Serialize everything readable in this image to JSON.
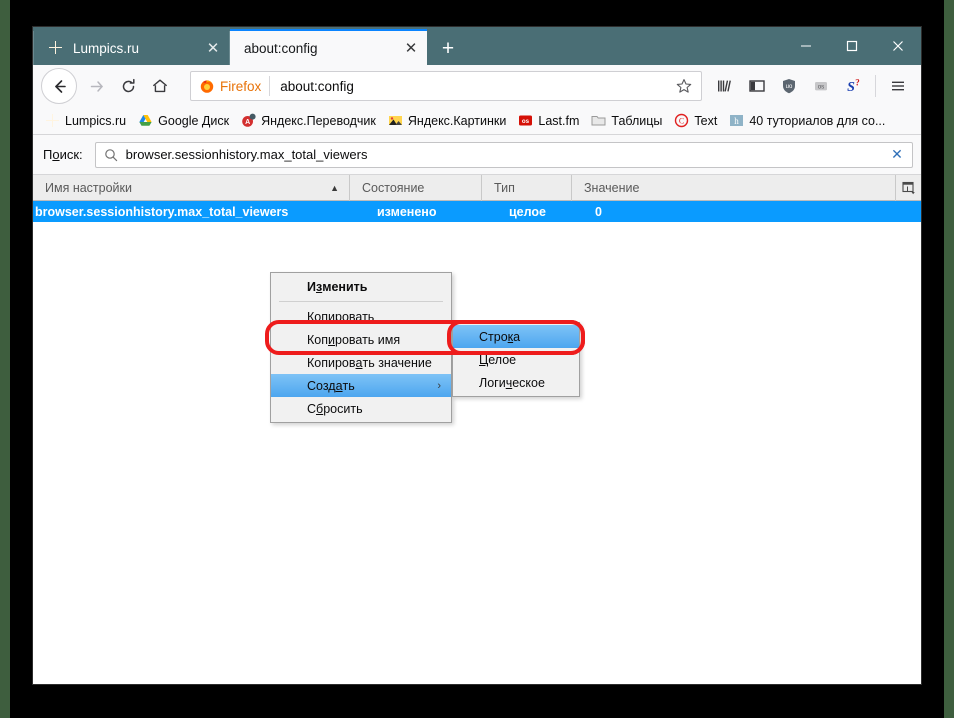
{
  "window": {
    "controls": {
      "minimize": "—",
      "maximize": "☐",
      "close": "✕"
    }
  },
  "tabs": [
    {
      "label": "Lumpics.ru",
      "icon": "lumpics-favicon",
      "close": "✕",
      "active": false
    },
    {
      "label": "about:config",
      "icon": "none",
      "close": "✕",
      "active": true
    }
  ],
  "newtab_label": "+",
  "toolbar": {
    "back_icon": "←",
    "forward_icon": "→",
    "reload_icon": "⟳",
    "home_icon": "⌂",
    "identity_label": "Firefox",
    "url": "about:config",
    "bookmark_star": "☆",
    "icons": [
      "library-icon",
      "sidebar-icon",
      "ublock-shield-icon",
      "os-badge-icon",
      "s-logo-icon"
    ],
    "menu_icon": "☰"
  },
  "bookmarks": [
    {
      "label": "Lumpics.ru",
      "icon": "lumpics-favicon"
    },
    {
      "label": "Google Диск",
      "icon": "google-drive-icon"
    },
    {
      "label": "Яндекс.Переводчик",
      "icon": "yandex-translate-icon"
    },
    {
      "label": "Яндекс.Картинки",
      "icon": "yandex-images-icon"
    },
    {
      "label": "Last.fm",
      "icon": "lastfm-icon"
    },
    {
      "label": "Таблицы",
      "icon": "folder-icon"
    },
    {
      "label": "Text",
      "icon": "copyright-c-icon"
    },
    {
      "label": "40 туториалов для со...",
      "icon": "habr-h-icon"
    }
  ],
  "search": {
    "label_prefix": "П",
    "label_accel": "о",
    "label_suffix": "иск:",
    "value": "browser.sessionhistory.max_total_viewers",
    "placeholder": "Поиск",
    "clear_icon": "✕"
  },
  "table": {
    "columns": [
      {
        "key": "name",
        "label": "Имя настройки",
        "sort": "▲"
      },
      {
        "key": "state",
        "label": "Состояние"
      },
      {
        "key": "type",
        "label": "Тип"
      },
      {
        "key": "value",
        "label": "Значение"
      }
    ],
    "column_picker_icon": "columns-icon",
    "rows": [
      {
        "name": "browser.sessionhistory.max_total_viewers",
        "state": "изменено",
        "type": "целое",
        "value": "0",
        "selected": true
      }
    ]
  },
  "context_menu": {
    "items": [
      {
        "pre": "И",
        "accel": "з",
        "post": "менить",
        "bold": true,
        "submenu": false,
        "selected": false
      },
      {
        "pre": "Ко",
        "accel": "п",
        "post": "ировать",
        "bold": false,
        "submenu": false,
        "selected": false
      },
      {
        "pre": "Коп",
        "accel": "и",
        "post": "ровать имя",
        "bold": false,
        "submenu": false,
        "selected": false
      },
      {
        "pre": "Копиров",
        "accel": "а",
        "post": "ть значение",
        "bold": false,
        "submenu": false,
        "selected": false
      },
      {
        "pre": "Созд",
        "accel": "а",
        "post": "ть",
        "bold": false,
        "submenu": true,
        "selected": true
      },
      {
        "pre": "С",
        "accel": "б",
        "post": "росить",
        "bold": false,
        "submenu": false,
        "selected": false
      }
    ],
    "submenu_arrow": "›"
  },
  "submenu": {
    "items": [
      {
        "pre": "Стро",
        "accel": "к",
        "post": "а",
        "selected": true
      },
      {
        "pre": "",
        "accel": "Ц",
        "post": "елое",
        "selected": false
      },
      {
        "pre": "Логи",
        "accel": "ч",
        "post": "еское",
        "selected": false
      }
    ]
  },
  "annotations": {
    "highlight_color": "#ee1c1c",
    "ovals": [
      "create-menu-item",
      "string-submenu-item"
    ]
  },
  "colors": {
    "tabstrip": "#4a6e75",
    "selection_blue": "#0a9bff",
    "accent_orange": "#e8730a",
    "menu_highlight": "#5fb2f2"
  }
}
